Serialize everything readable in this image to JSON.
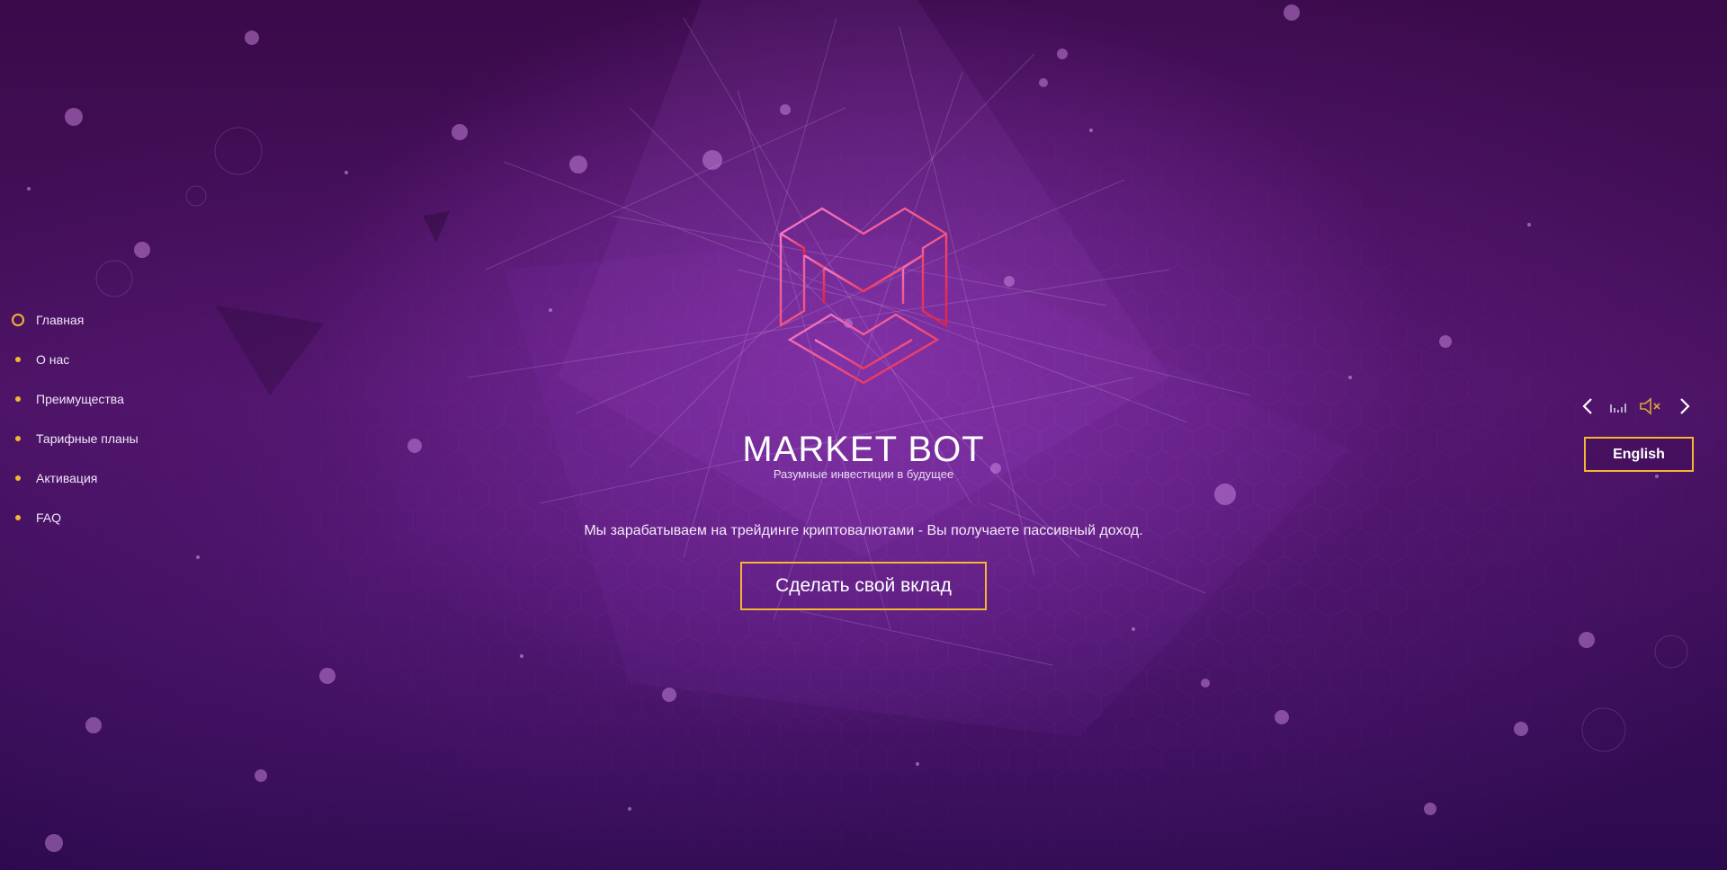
{
  "nav": {
    "items": [
      {
        "label": "Главная",
        "active": true
      },
      {
        "label": "О нас",
        "active": false
      },
      {
        "label": "Преимущества",
        "active": false
      },
      {
        "label": "Тарифные планы",
        "active": false
      },
      {
        "label": "Активация",
        "active": false
      },
      {
        "label": "FAQ",
        "active": false
      }
    ]
  },
  "hero": {
    "title": "MARKET BOT",
    "subtitle": "Разумные инвестиции в будущее",
    "tagline": "Мы зарабатываем на трейдинге криптовалютами - Вы получаете пассивный доход.",
    "cta_label": "Сделать свой вклад"
  },
  "controls": {
    "prev_icon": "chevron-left-icon",
    "equalizer_icon": "equalizer-icon",
    "sound_icon": "speaker-muted-icon",
    "next_icon": "chevron-right-icon",
    "language_label": "English"
  },
  "colors": {
    "accent": "#f4b731",
    "logo_pink": "#f27bd4",
    "logo_red": "#ea1f3c",
    "background_dark": "#3a0a4a",
    "background_mid": "#6a2a8a"
  }
}
